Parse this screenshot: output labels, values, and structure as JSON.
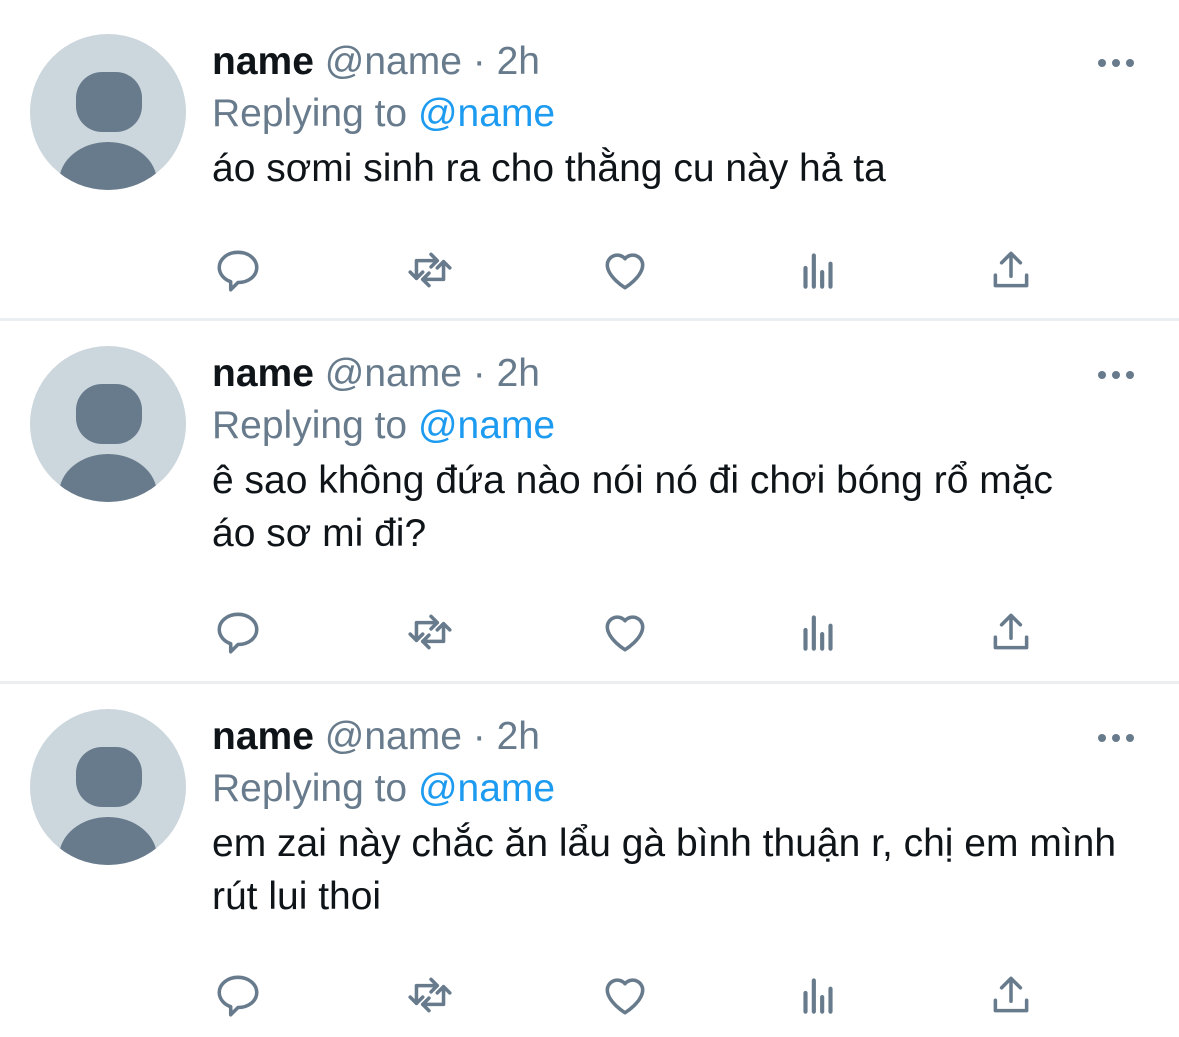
{
  "tweets": [
    {
      "display_name": "name",
      "handle": "@name",
      "separator": "·",
      "time": "2h",
      "replying_prefix": "Replying to",
      "replying_handle": "@name",
      "text": "áo sơmi sinh ra cho thằng cu này hả ta"
    },
    {
      "display_name": "name",
      "handle": "@name",
      "separator": "·",
      "time": "2h",
      "replying_prefix": "Replying to",
      "replying_handle": "@name",
      "text": "ê sao không đứa nào nói nó đi chơi bóng rổ mặc áo sơ mi đi?"
    },
    {
      "display_name": "name",
      "handle": "@name",
      "separator": "·",
      "time": "2h",
      "replying_prefix": "Replying to",
      "replying_handle": "@name",
      "text": "em zai này chắc ăn lẩu gà bình thuận r, chị em mình rút lui thoi"
    }
  ],
  "icons": {
    "more": "more-options-icon",
    "reply": "reply-icon",
    "retweet": "retweet-icon",
    "like": "like-icon",
    "views": "views-icon",
    "share": "share-icon"
  },
  "colors": {
    "accent": "#1d9bf0",
    "secondary_text": "#687b8c",
    "primary_text": "#0f1419",
    "divider": "#eceff1",
    "avatar_bg": "#ccd6dd"
  }
}
